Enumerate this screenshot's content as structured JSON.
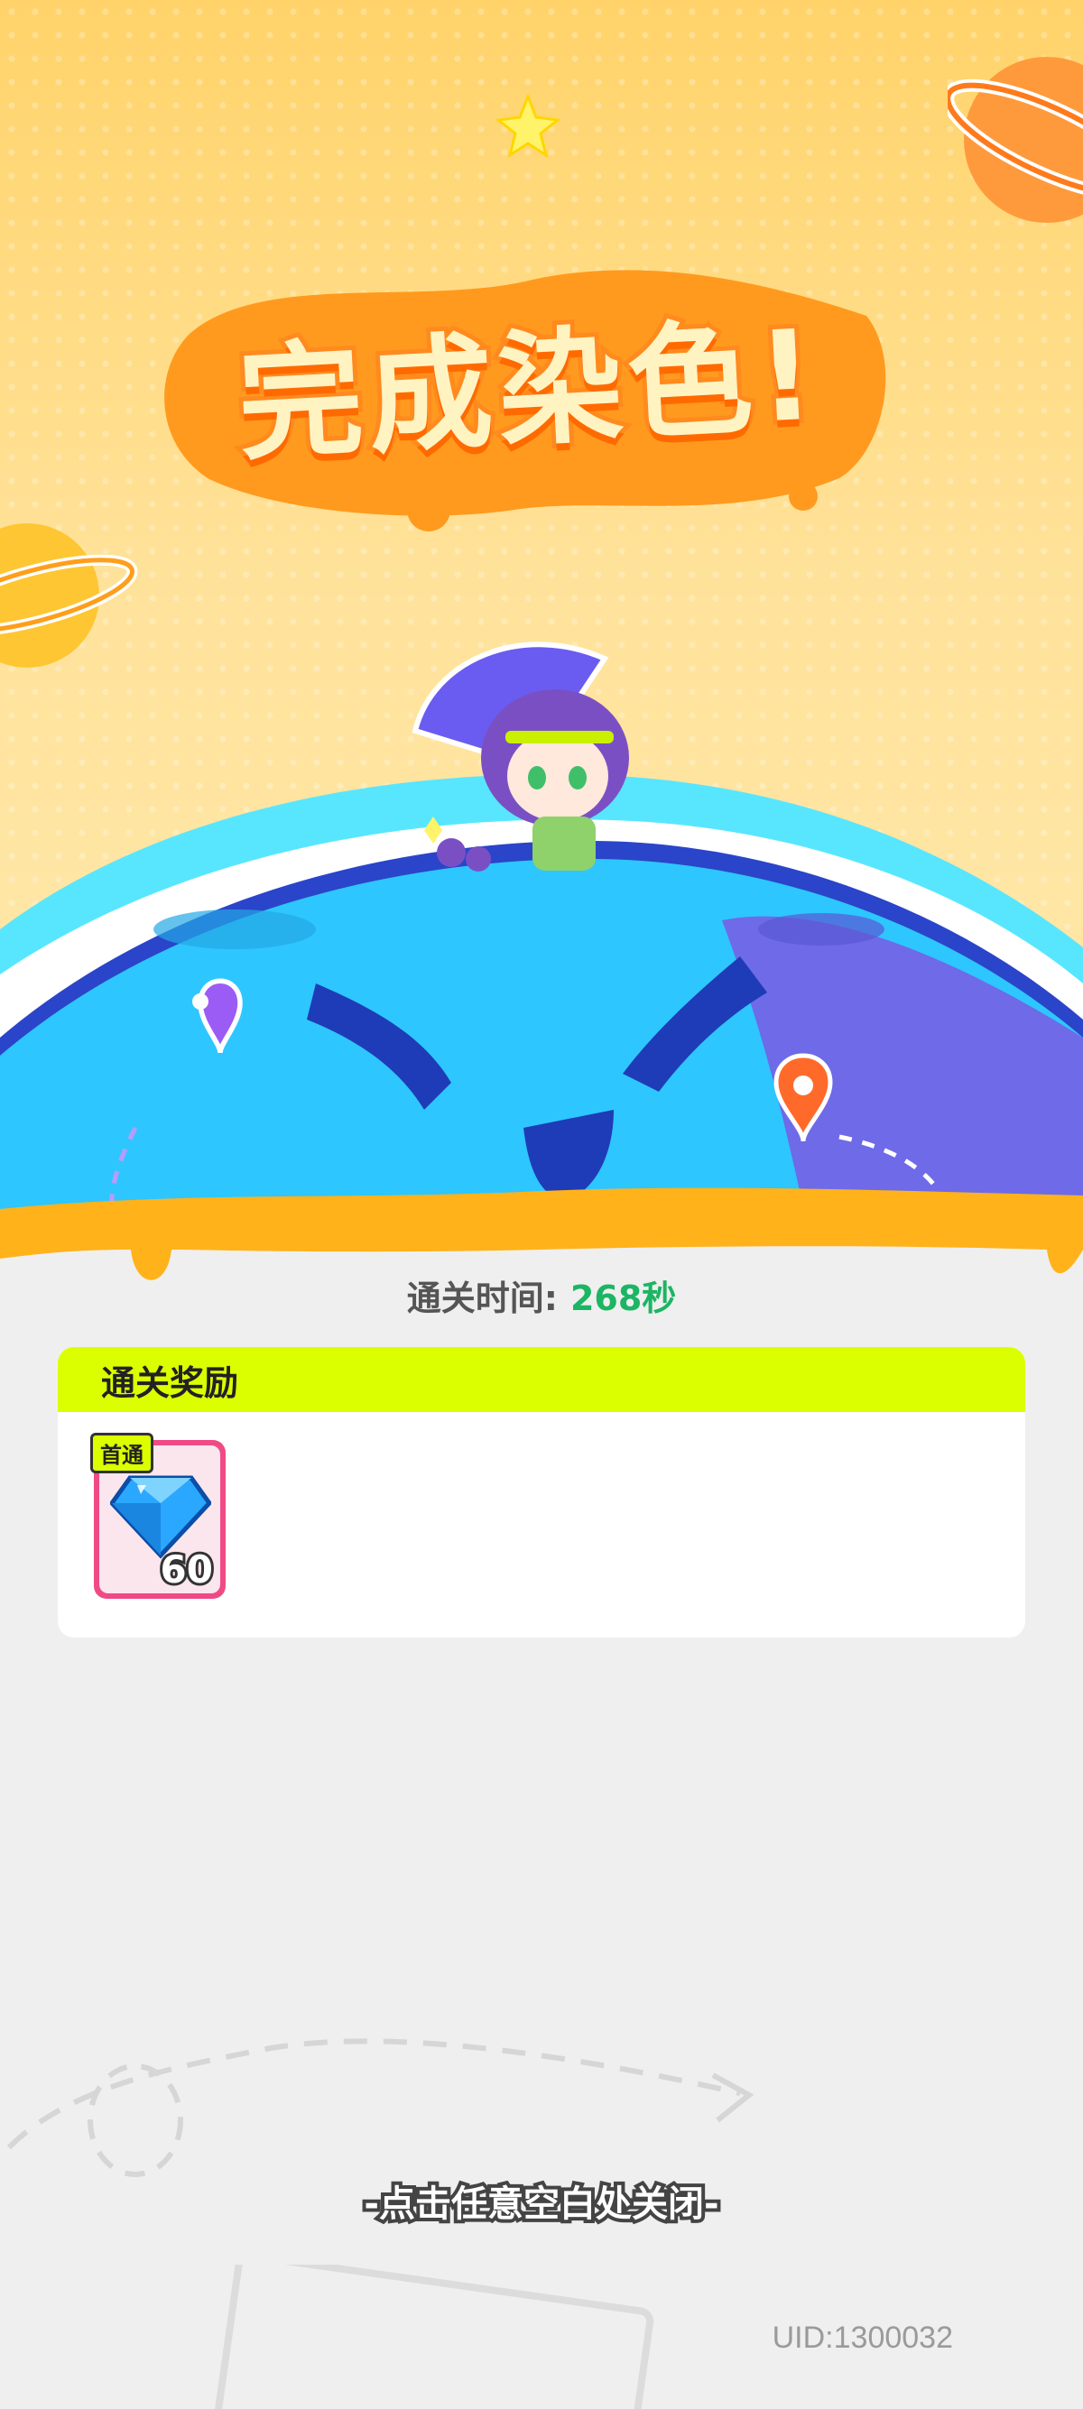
{
  "title": "完成染色!",
  "clear_time": {
    "label": "通关时间:",
    "value": "268秒"
  },
  "rewards": {
    "header": "通关奖励",
    "items": [
      {
        "badge": "首通",
        "icon": "blue-diamond-icon",
        "count": "60"
      }
    ]
  },
  "close_hint": "-点击任意空白处关闭-",
  "uid": "UID:1300032",
  "colors": {
    "background_top": "#ffd36a",
    "title_outline": "#ff8a1e",
    "planet_blue": "#2ec6ff",
    "reward_header": "#dcff00",
    "time_value": "#1cb563"
  }
}
